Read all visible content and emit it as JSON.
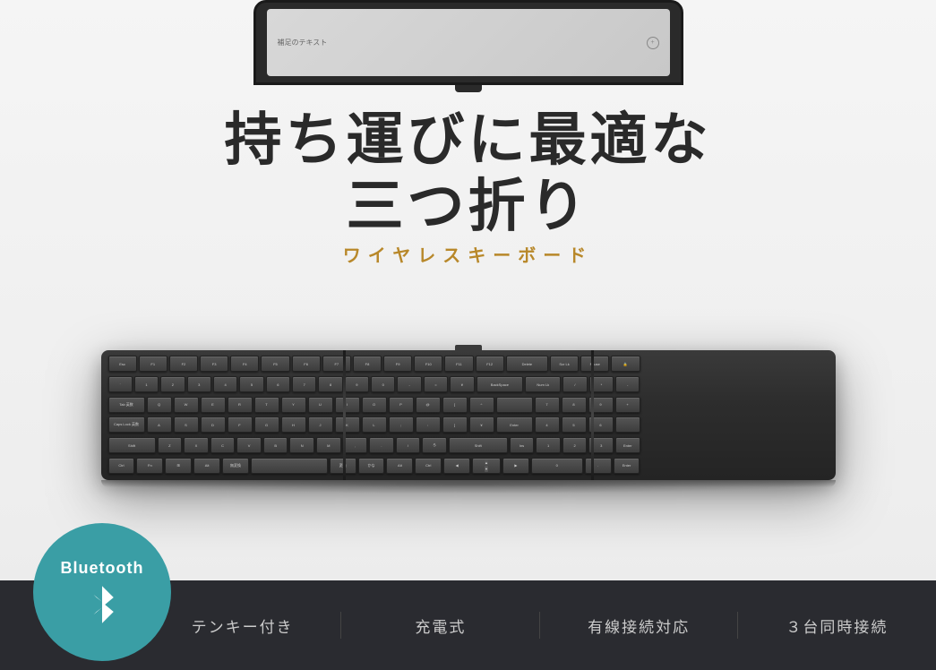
{
  "hero": {
    "title_line1": "持ち運びに最適な",
    "title_line2": "三つ折り",
    "subtitle": "ワイヤレスキーボード"
  },
  "bluetooth": {
    "label": "Bluetooth",
    "icon_label": "bluetooth-icon"
  },
  "features": [
    {
      "id": "tenkey",
      "label": "テンキー付き"
    },
    {
      "id": "charging",
      "label": "充電式"
    },
    {
      "id": "wired",
      "label": "有線接続対応"
    },
    {
      "id": "multidevice",
      "label": "３台同時接続"
    }
  ],
  "tablet": {
    "screen_text": "補足のテキスト",
    "icon_text": "+"
  },
  "colors": {
    "accent_gold": "#b8882a",
    "bluetooth_teal": "#3a9ea5",
    "bottom_bar": "#2a2b30",
    "keyboard_dark": "#2d2d2d"
  }
}
